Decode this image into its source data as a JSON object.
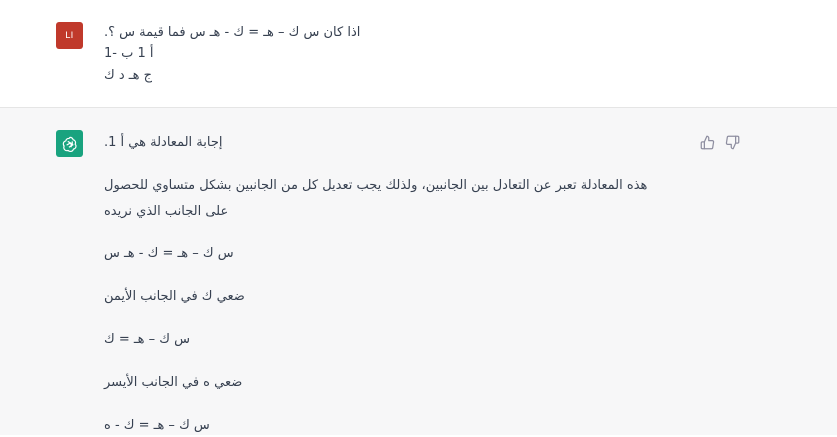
{
  "user": {
    "avatar_initials": "LI",
    "lines": [
      "اذا كان س ك – هـ = ك - هـ س فما قيمة س ؟.",
      "أ 1 ب -1",
      "ج هـ د ك"
    ]
  },
  "assistant": {
    "avatar_icon": "openai-logo-icon",
    "lines": [
      "إجابة المعادلة هي أ 1.",
      "هذه المعادلة تعبر عن التعادل بين الجانبين، ولذلك يجب تعديل كل من الجانبين بشكل متساوي للحصول",
      "على الجانب الذي نريده",
      "س ك – هـ = ك - هـ س",
      "ضعي ك في الجانب الأيمن",
      "س ك – هـ = ك",
      "ضعي ه في الجانب الأيسر",
      "س ك – هـ = ك - ه"
    ],
    "feedback": {
      "like_icon": "thumbs-up-icon",
      "dislike_icon": "thumbs-down-icon"
    }
  },
  "colors": {
    "user_avatar": "#c0392b",
    "bot_avatar": "#19a37f",
    "assistant_bg": "#f7f7f8",
    "text": "#374151"
  }
}
